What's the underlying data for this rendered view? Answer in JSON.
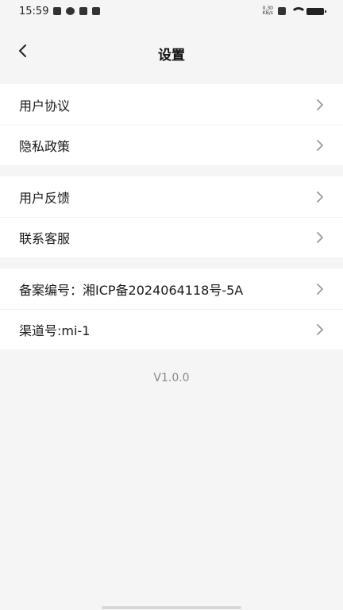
{
  "status_bar": {
    "time": "15:59",
    "net_speed_value": "0.30",
    "net_speed_unit": "KB/s",
    "icons": [
      "notification-icon",
      "sync-icon",
      "mail-icon",
      "shield-icon",
      "close-box-icon",
      "wifi-icon",
      "battery-icon"
    ]
  },
  "header": {
    "title": "设置",
    "back_icon": "chevron-left-icon"
  },
  "groups": [
    {
      "items": [
        {
          "label": "用户协议"
        },
        {
          "label": "隐私政策"
        }
      ]
    },
    {
      "items": [
        {
          "label": "用户反馈"
        },
        {
          "label": "联系客服"
        }
      ]
    },
    {
      "items": [
        {
          "label": "备案编号：湘ICP备2024064118号-5A"
        },
        {
          "label": "渠道号:mi-1"
        }
      ]
    }
  ],
  "version": "V1.0.0",
  "colors": {
    "background": "#f5f5f5",
    "card": "#ffffff",
    "chevron": "#999999",
    "version_text": "#888888"
  }
}
